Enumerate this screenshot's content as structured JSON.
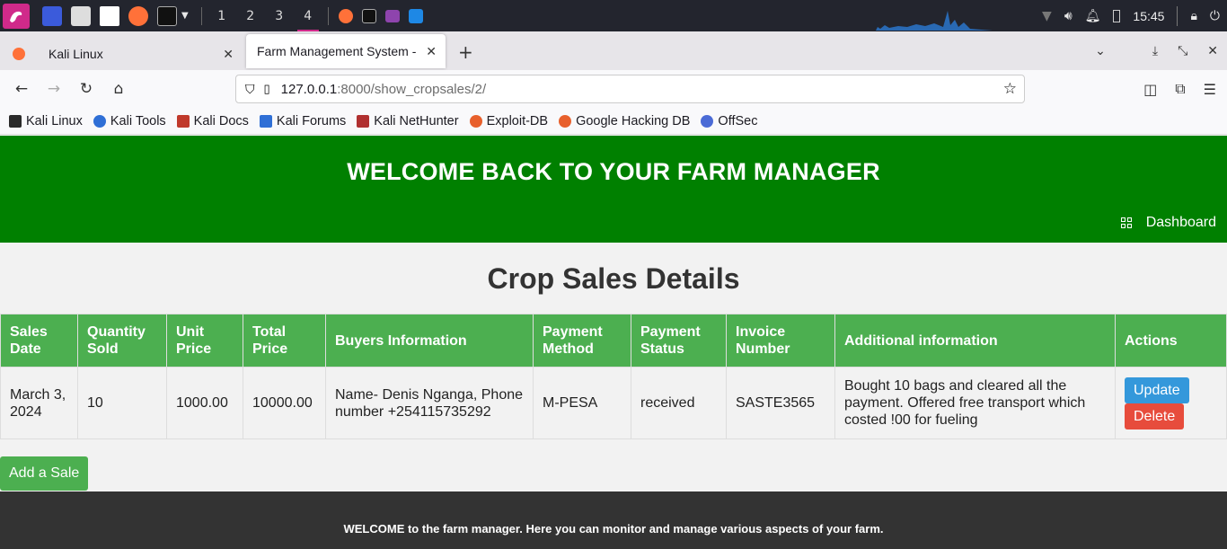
{
  "taskbar": {
    "workspaces": [
      "1",
      "2",
      "3",
      "4"
    ],
    "active_workspace": "4",
    "clock": "15:45"
  },
  "browser": {
    "tabs": [
      {
        "label": "Kali Linux"
      },
      {
        "label": "Farm Management System -"
      }
    ],
    "url_host": "127.0.0.1",
    "url_rest": ":8000/show_cropsales/2/",
    "bookmarks": [
      "Kali Linux",
      "Kali Tools",
      "Kali Docs",
      "Kali Forums",
      "Kali NetHunter",
      "Exploit-DB",
      "Google Hacking DB",
      "OffSec"
    ]
  },
  "colors": {
    "header_green": "#008000",
    "table_header": "#4caf50",
    "update_blue": "#3498db",
    "delete_red": "#e74c3c",
    "footer": "#333333"
  },
  "page": {
    "header_title": "WELCOME BACK TO YOUR FARM MANAGER",
    "dashboard_link": "Dashboard",
    "title": "Crop Sales Details",
    "columns": [
      "Sales Date",
      "Quantity Sold",
      "Unit Price",
      "Total Price",
      "Buyers Information",
      "Payment Method",
      "Payment Status",
      "Invoice Number",
      "Additional information",
      "Actions"
    ],
    "rows": [
      {
        "sales_date": "March 3, 2024",
        "quantity": "10",
        "unit_price": "1000.00",
        "total_price": "10000.00",
        "buyer": "Name- Denis Nganga, Phone number +254115735292",
        "payment_method": "M-PESA",
        "payment_status": "received",
        "invoice": "SASTE3565",
        "additional": "Bought 10 bags and cleared all the payment. Offered free transport which costed !00 for fueling",
        "update_label": "Update",
        "delete_label": "Delete"
      }
    ],
    "add_sale_label": "Add a Sale",
    "footer_text": "WELCOME to the farm manager. Here you can monitor and manage various aspects of your farm."
  }
}
